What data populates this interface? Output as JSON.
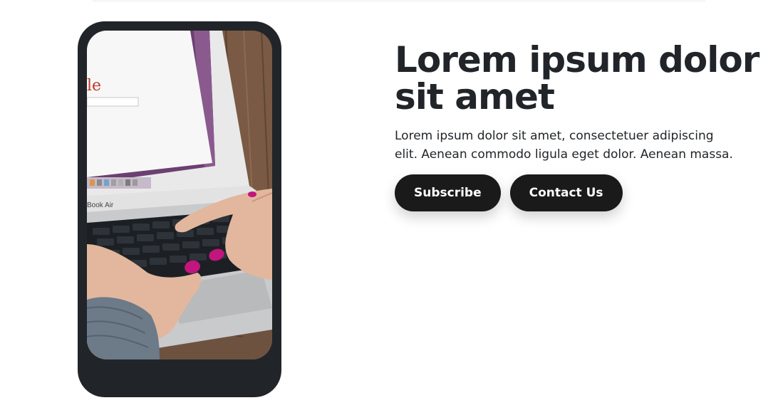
{
  "hero": {
    "title": "Lorem ipsum dolor sit amet",
    "description": "Lorem ipsum dolor sit amet, consectetuer adipiscing elit. Aenean commodo ligula eget dolor. Aenean massa."
  },
  "buttons": {
    "subscribe_label": "Subscribe",
    "contact_label": "Contact Us"
  },
  "phone_screen": {
    "image_name": "laptop-typing-photo",
    "laptop_brand_text": "Book Air",
    "browser_logo_text": "le"
  },
  "colors": {
    "phone_frame": "#212529",
    "button_background": "#1a1a1a",
    "button_text": "#ffffff",
    "text": "#212529",
    "nail_polish": "#c2157e"
  }
}
